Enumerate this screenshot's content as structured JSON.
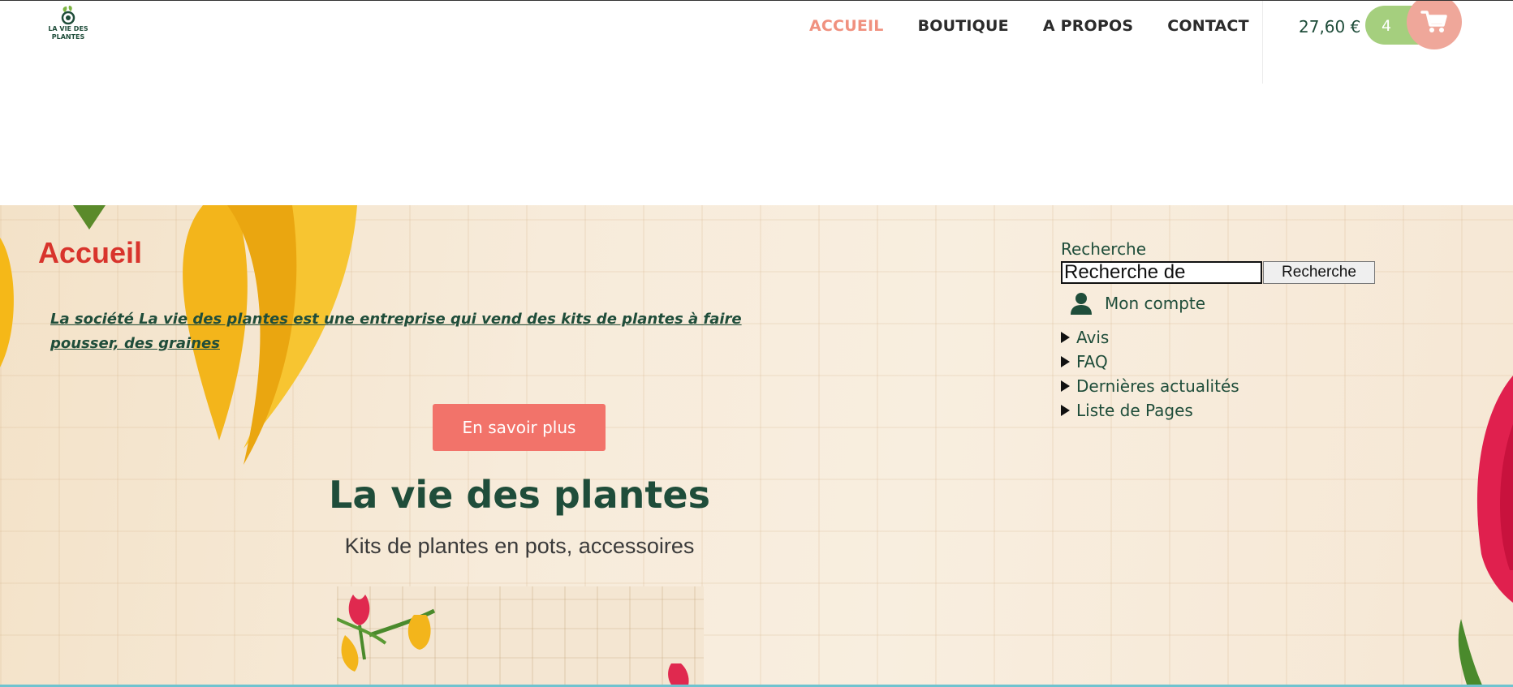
{
  "header": {
    "logo_text_line1": "LA VIE DES",
    "logo_text_line2": "PLANTES",
    "nav": [
      {
        "label": "ACCUEIL",
        "active": true
      },
      {
        "label": "BOUTIQUE",
        "active": false
      },
      {
        "label": "A PROPOS",
        "active": false
      },
      {
        "label": "CONTACT",
        "active": false
      }
    ],
    "cart_total": "27,60 €",
    "cart_count": "4",
    "cart_icon": "cart-icon"
  },
  "main": {
    "page_title": "Accueil",
    "intro": "La société La vie des plantes est une entreprise qui vend des kits de plantes à faire pousser, des graines",
    "cta_label": "En savoir plus",
    "site_title": "La vie des plantes",
    "site_subtitle": "Kits de plantes en pots, accessoires"
  },
  "sidebar": {
    "search_label": "Recherche",
    "search_value": "Recherche de produits",
    "search_button": "Recherche",
    "account_label": "Mon compte",
    "account_icon": "user-icon",
    "links": [
      {
        "label": "Avis"
      },
      {
        "label": "FAQ"
      },
      {
        "label": "Dernières actualités"
      },
      {
        "label": "Liste de Pages"
      }
    ]
  },
  "colors": {
    "brand_green": "#1f4d3a",
    "nav_active": "#f0917f",
    "cart_pill": "#a5cf7e",
    "cart_circle": "#efa79a",
    "cta": "#f2736a",
    "page_title": "#d8342c"
  }
}
